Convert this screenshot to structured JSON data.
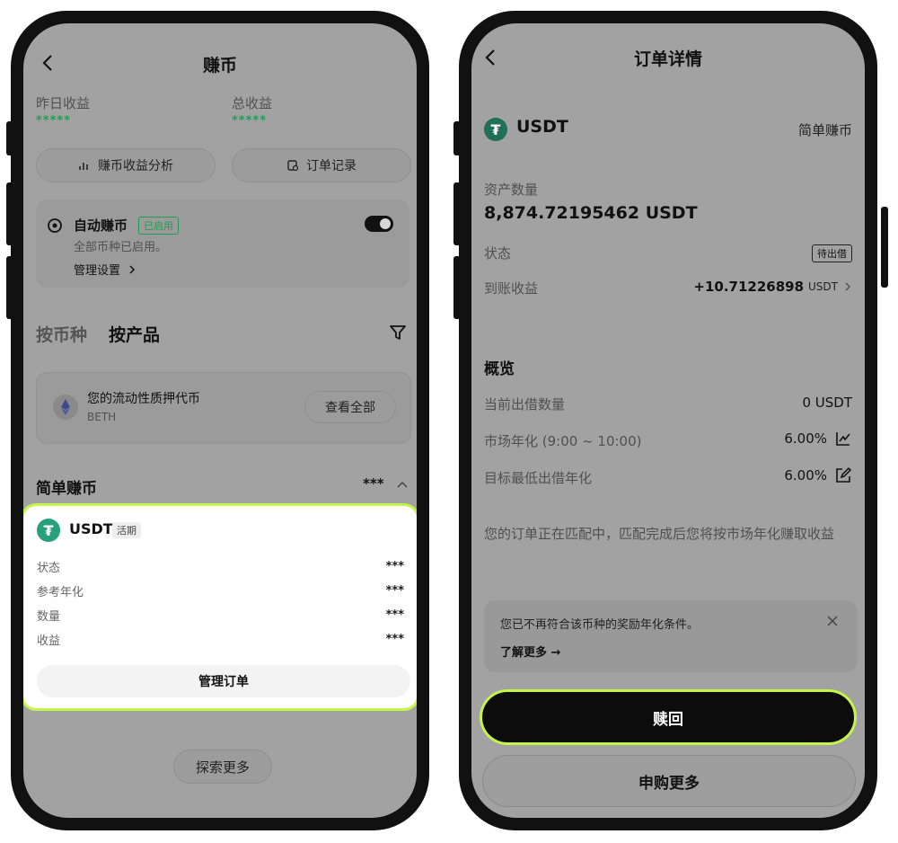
{
  "left": {
    "header": {
      "title": "赚币"
    },
    "summary": {
      "yesterday_label": "昨日收益",
      "yesterday_value": "*****",
      "total_label": "总收益",
      "total_value": "*****"
    },
    "actions": {
      "analysis_label": "赚币收益分析",
      "orders_label": "订单记录"
    },
    "auto_earn": {
      "title": "自动赚币",
      "badge": "已启用",
      "desc": "全部币种已启用。",
      "manage_label": "管理设置"
    },
    "tabs": {
      "by_coin": "按币种",
      "by_product": "按产品"
    },
    "liquidity": {
      "title": "您的流动性质押代币",
      "subtitle": "BETH",
      "view_all": "查看全部"
    },
    "simple_earn": {
      "title": "简单赚币",
      "masked": "***"
    },
    "usdt_card": {
      "coin": "USDT",
      "badge": "活期",
      "rows": [
        {
          "label": "状态",
          "value": "***"
        },
        {
          "label": "参考年化",
          "value": "***"
        },
        {
          "label": "数量",
          "value": "***"
        },
        {
          "label": "收益",
          "value": "***"
        }
      ],
      "manage_btn": "管理订单"
    },
    "explore_btn": "探索更多"
  },
  "right": {
    "header": {
      "title": "订单详情"
    },
    "coin": "USDT",
    "product": "简单赚币",
    "asset_label": "资产数量",
    "asset_value": "8,874.72195462 USDT",
    "status_label": "状态",
    "status_value": "待出借",
    "earnings_label": "到账收益",
    "earnings_value": "+10.71226898",
    "earnings_unit": "USDT",
    "overview_title": "概览",
    "overview": [
      {
        "label": "当前出借数量",
        "value": "0 USDT"
      },
      {
        "label": "市场年化 (9:00 ~ 10:00)",
        "value": "6.00%"
      },
      {
        "label": "目标最低出借年化",
        "value": "6.00%"
      }
    ],
    "note": "您的订单正在匹配中，匹配完成后您将按市场年化赚取收益",
    "notice": {
      "text": "您已不再符合该币种的奖励年化条件。",
      "link": "了解更多 →"
    },
    "redeem_btn": "赎回",
    "subscribe_btn": "申购更多"
  },
  "colors": {
    "accent_green": "#c4f54a",
    "tether": "#26a17b",
    "stars": "#1f9e53"
  },
  "icons": [
    "back-arrow-icon",
    "chart-icon",
    "receipt-icon",
    "target-icon",
    "chevron-right-icon",
    "filter-icon",
    "ethereum-icon",
    "chevron-up-icon",
    "tether-icon",
    "trend-icon",
    "edit-icon",
    "close-icon"
  ]
}
